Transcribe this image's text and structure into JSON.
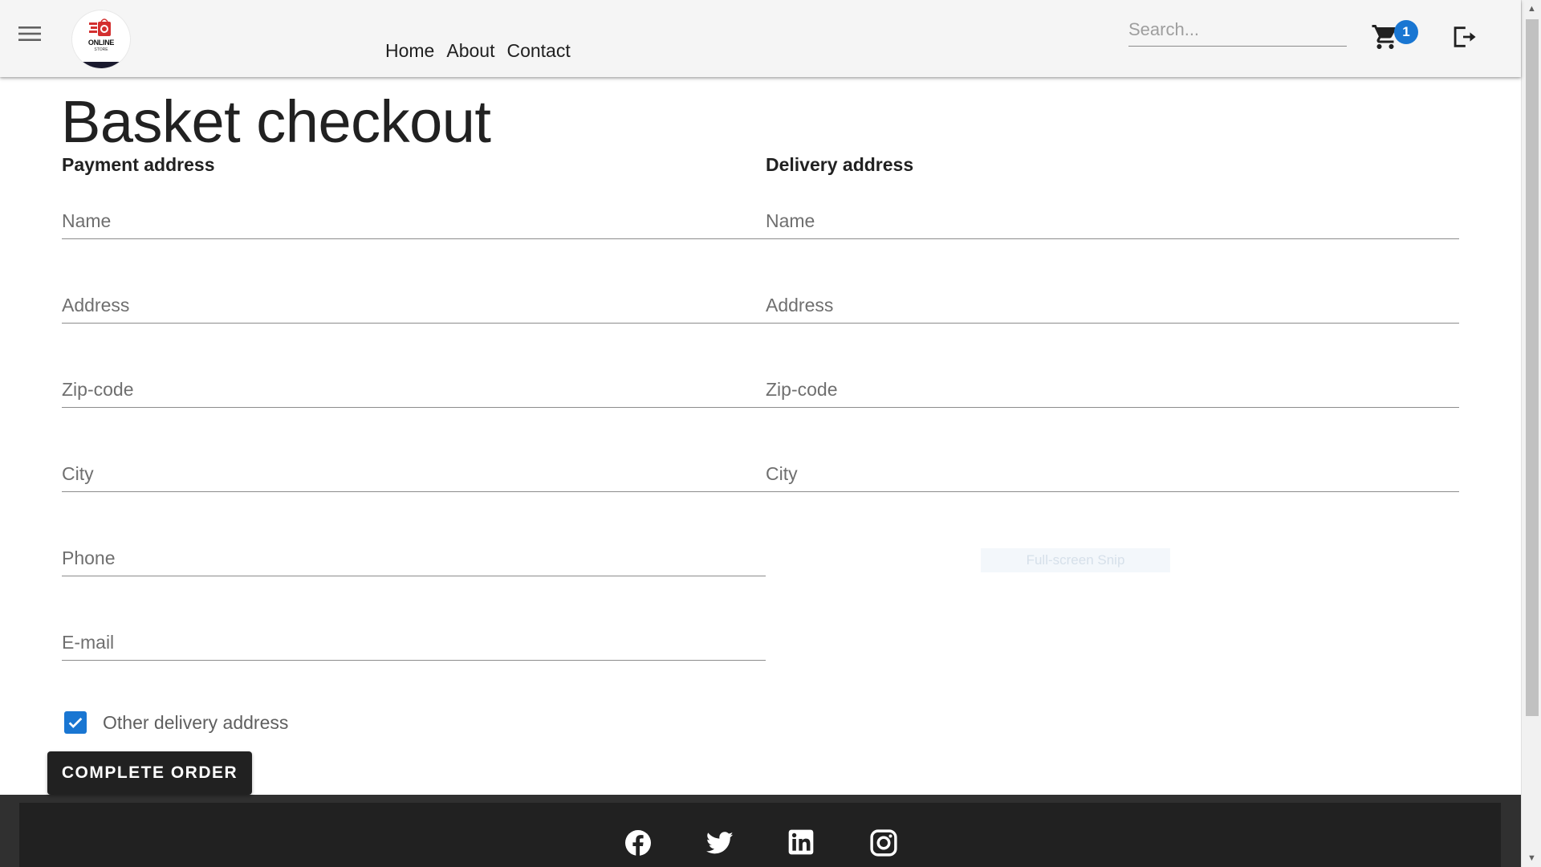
{
  "header": {
    "logo": {
      "line1": "ONLINE",
      "line2": "STORE"
    },
    "nav": [
      {
        "label": "Home"
      },
      {
        "label": "About"
      },
      {
        "label": "Contact"
      }
    ],
    "search": {
      "placeholder": "Search...",
      "value": ""
    },
    "cart": {
      "icon": "cart-icon",
      "badge_count": "1"
    },
    "logout": {
      "icon": "logout-icon"
    },
    "menu": {
      "icon": "hamburger-menu-icon"
    }
  },
  "main": {
    "title": "Basket checkout",
    "payment": {
      "heading": "Payment address",
      "fields": [
        {
          "placeholder": "Name",
          "value": ""
        },
        {
          "placeholder": "Address",
          "value": ""
        },
        {
          "placeholder": "Zip-code",
          "value": ""
        },
        {
          "placeholder": "City",
          "value": ""
        },
        {
          "placeholder": "Phone",
          "value": ""
        },
        {
          "placeholder": "E-mail",
          "value": ""
        }
      ]
    },
    "delivery": {
      "heading": "Delivery address",
      "fields": [
        {
          "placeholder": "Name",
          "value": ""
        },
        {
          "placeholder": "Address",
          "value": ""
        },
        {
          "placeholder": "Zip-code",
          "value": ""
        },
        {
          "placeholder": "City",
          "value": ""
        }
      ]
    },
    "other_delivery": {
      "label": "Other delivery address",
      "checked": true
    },
    "complete_button": "COMPLETE ORDER"
  },
  "overlay": {
    "snip_text": "Full-screen Snip"
  },
  "footer": {
    "social": [
      {
        "icon": "facebook-icon"
      },
      {
        "icon": "twitter-icon"
      },
      {
        "icon": "linkedin-icon"
      },
      {
        "icon": "instagram-icon"
      }
    ]
  },
  "colors": {
    "accent": "#1976d2",
    "header_bg": "#f5f5f5",
    "footer_bg": "#212121",
    "button_bg": "#212121"
  }
}
